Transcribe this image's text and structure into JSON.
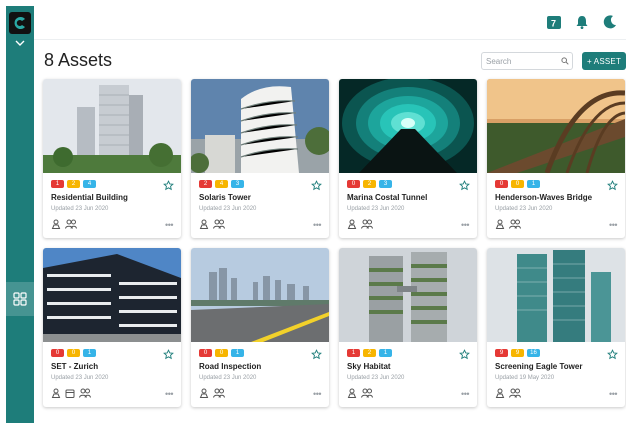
{
  "header": {
    "title": "8 Assets"
  },
  "search": {
    "placeholder": "Search"
  },
  "actions": {
    "add_label": "+ ASSET"
  },
  "colors": {
    "accent": "#1e7d7a",
    "badge_red": "#e53935",
    "badge_yellow": "#f7b500",
    "badge_blue": "#36b4e8"
  },
  "top_icons": [
    "calendar-seven-icon",
    "bell-icon",
    "moon-icon"
  ],
  "assets": [
    {
      "name": "Residential Building",
      "updated": "Updated 23 Jun 2020",
      "badges": [
        "1",
        "2",
        "4"
      ]
    },
    {
      "name": "Solaris Tower",
      "updated": "Updated 23 Jun 2020",
      "badges": [
        "2",
        "4",
        "3"
      ]
    },
    {
      "name": "Marina Costal Tunnel",
      "updated": "Updated 23 Jun 2020",
      "badges": [
        "0",
        "2",
        "3"
      ]
    },
    {
      "name": "Henderson-Waves Bridge",
      "updated": "Updated 23 Jun 2020",
      "badges": [
        "0",
        "0",
        "1"
      ]
    },
    {
      "name": "SET - Zurich",
      "updated": "Updated 23 Jun 2020",
      "badges": [
        "0",
        "0",
        "1"
      ]
    },
    {
      "name": "Road Inspection",
      "updated": "Updated 23 Jun 2020",
      "badges": [
        "0",
        "0",
        "1"
      ]
    },
    {
      "name": "Sky Habitat",
      "updated": "Updated 23 Jun 2020",
      "badges": [
        "1",
        "2",
        "1"
      ]
    },
    {
      "name": "Screening Eagle Tower",
      "updated": "Updated 19 May 2020",
      "badges": [
        "9",
        "9",
        "16"
      ]
    }
  ]
}
